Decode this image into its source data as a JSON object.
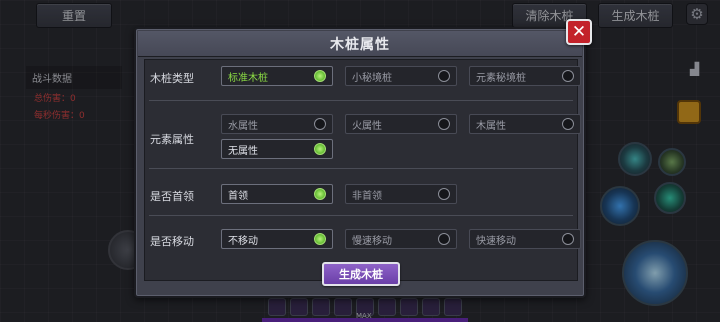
{
  "topbar": {
    "reset_label": "重置",
    "clear_label": "清除木桩",
    "generate_label": "生成木桩"
  },
  "battle": {
    "title": "战斗数据",
    "total_damage": "总伤害：0",
    "dps": "每秒伤害：0"
  },
  "hud": {
    "max_label": "MAX"
  },
  "modal": {
    "title": "木桩属性",
    "close_icon": "close-icon",
    "rows": [
      {
        "label": "木桩类型",
        "options": [
          {
            "label": "标准木桩",
            "selected": true
          },
          {
            "label": "小秘境桩",
            "selected": false
          },
          {
            "label": "元素秘境桩",
            "selected": false
          }
        ]
      },
      {
        "label": "元素属性",
        "options": [
          {
            "label": "水属性",
            "selected": false
          },
          {
            "label": "火属性",
            "selected": false
          },
          {
            "label": "木属性",
            "selected": false
          },
          {
            "label": "无属性",
            "selected": true
          }
        ]
      },
      {
        "label": "是否首领",
        "options": [
          {
            "label": "首领",
            "selected": true
          },
          {
            "label": "非首领",
            "selected": false
          }
        ]
      },
      {
        "label": "是否移动",
        "options": [
          {
            "label": "不移动",
            "selected": true
          },
          {
            "label": "慢速移动",
            "selected": false
          },
          {
            "label": "快速移动",
            "selected": false
          }
        ]
      }
    ],
    "submit_label": "生成木桩"
  },
  "colors": {
    "accent_green": "#8bdc44",
    "close_red": "#c3222a",
    "submit_purple": "#7a4fb8"
  }
}
